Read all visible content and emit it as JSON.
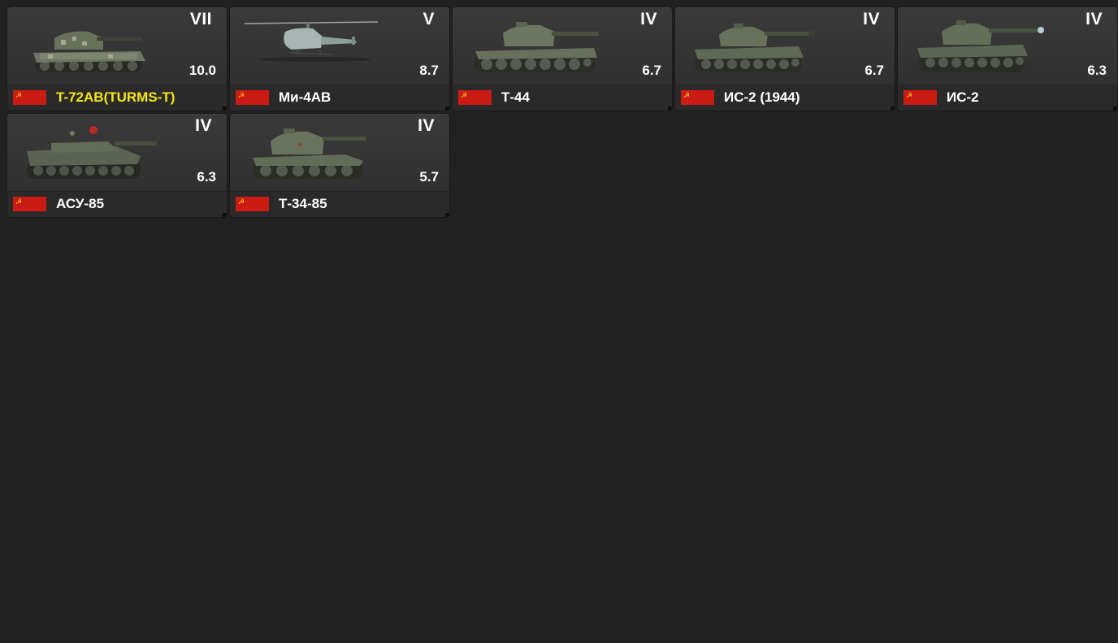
{
  "colors": {
    "background": "#212121",
    "card": "#343434",
    "flag_red": "#cc1a14",
    "premium_name": "#f5e71a",
    "text": "#ffffff"
  },
  "vehicles": [
    {
      "tier": "VII",
      "rating": "10.0",
      "name": "T-72AB(TURMS-T)",
      "premium": true,
      "kind": "tank",
      "nation_flag": "ussr-flag-icon"
    },
    {
      "tier": "V",
      "rating": "8.7",
      "name": "Ми-4АВ",
      "premium": false,
      "kind": "helicopter",
      "nation_flag": "ussr-flag-icon"
    },
    {
      "tier": "IV",
      "rating": "6.7",
      "name": "Т-44",
      "premium": false,
      "kind": "tank",
      "nation_flag": "ussr-flag-icon"
    },
    {
      "tier": "IV",
      "rating": "6.7",
      "name": "ИС-2 (1944)",
      "premium": false,
      "kind": "tank",
      "nation_flag": "ussr-flag-icon"
    },
    {
      "tier": "IV",
      "rating": "6.3",
      "name": "ИС-2",
      "premium": false,
      "kind": "tank",
      "nation_flag": "ussr-flag-icon"
    },
    {
      "tier": "IV",
      "rating": "6.3",
      "name": "АСУ-85",
      "premium": false,
      "kind": "tank-destroyer",
      "nation_flag": "ussr-flag-icon"
    },
    {
      "tier": "IV",
      "rating": "5.7",
      "name": "Т-34-85",
      "premium": false,
      "kind": "tank",
      "nation_flag": "ussr-flag-icon"
    }
  ]
}
